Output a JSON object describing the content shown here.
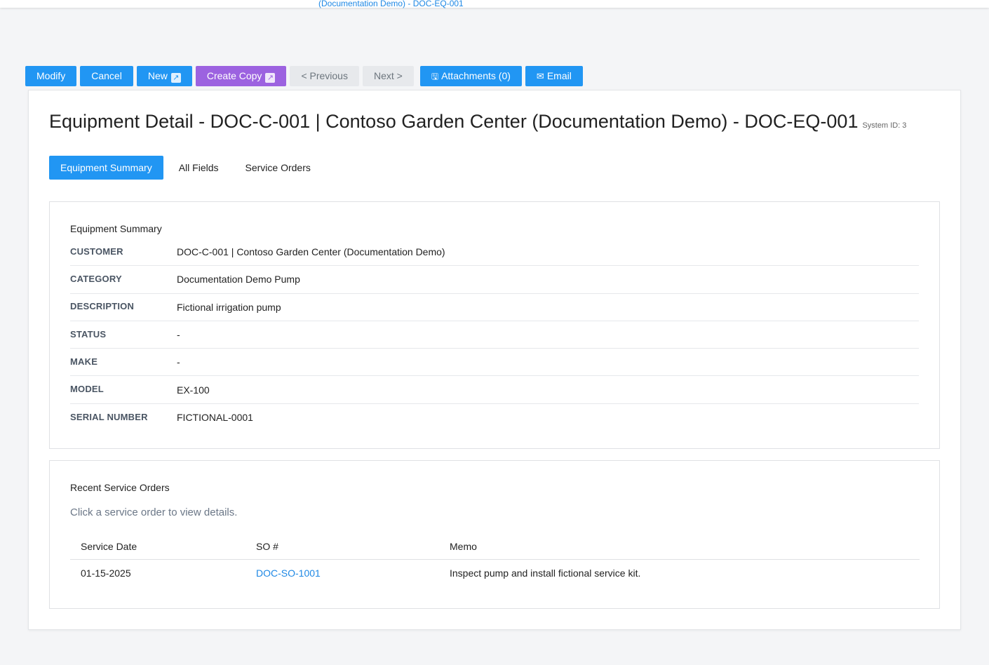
{
  "header": {
    "crumb": "(Documentation Demo) - DOC-EQ-001"
  },
  "toolbar": {
    "modify": "Modify",
    "cancel": "Cancel",
    "new": "New",
    "create_copy": "Create Copy",
    "previous": "< Previous",
    "next": "Next >",
    "attachments": "Attachments (0)",
    "email": "Email",
    "external_icon": "↗",
    "attachments_icon": "🖫",
    "email_icon": "✉"
  },
  "page": {
    "title": "Equipment Detail - DOC-C-001 | Contoso Garden Center (Documentation Demo) - DOC-EQ-001",
    "system_id": "System ID: 3"
  },
  "tabs": [
    {
      "label": "Equipment Summary",
      "active": true
    },
    {
      "label": "All Fields",
      "active": false
    },
    {
      "label": "Service Orders",
      "active": false
    }
  ],
  "summary": {
    "title": "Equipment Summary",
    "fields": [
      {
        "label": "CUSTOMER",
        "value": "DOC-C-001 | Contoso Garden Center (Documentation Demo)"
      },
      {
        "label": "CATEGORY",
        "value": "Documentation Demo Pump"
      },
      {
        "label": "DESCRIPTION",
        "value": "Fictional irrigation pump"
      },
      {
        "label": "STATUS",
        "value": "-"
      },
      {
        "label": "MAKE",
        "value": "-"
      },
      {
        "label": "MODEL",
        "value": "EX-100"
      },
      {
        "label": "SERIAL NUMBER",
        "value": "FICTIONAL-0001"
      }
    ]
  },
  "orders": {
    "title": "Recent Service Orders",
    "hint": "Click a service order to view details.",
    "columns": [
      "Service Date",
      "SO #",
      "Memo"
    ],
    "rows": [
      {
        "date": "01-15-2025",
        "so": "DOC-SO-1001",
        "memo": "Inspect pump and install fictional service kit."
      }
    ]
  },
  "colors": {
    "primary": "#2196f3",
    "purple": "#9c62e0",
    "disabled": "#e7e9ec",
    "link": "#1e88e5"
  }
}
